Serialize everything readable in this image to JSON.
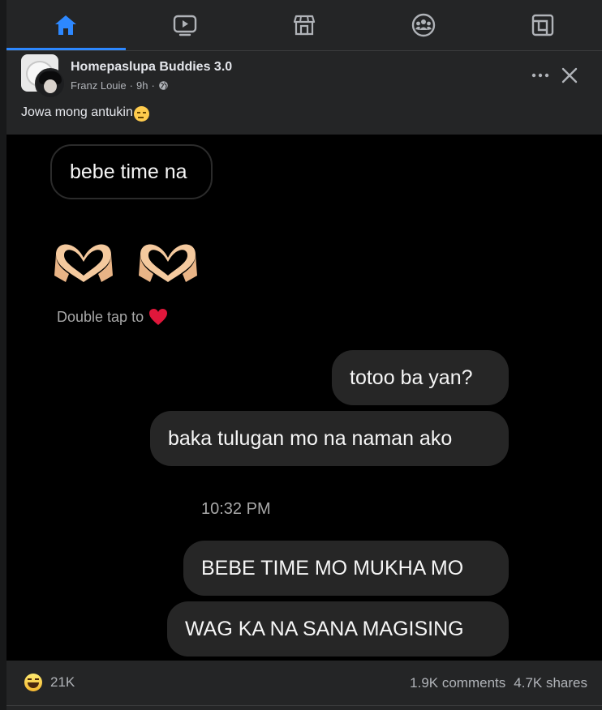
{
  "nav": {
    "tabs": [
      {
        "name": "home",
        "icon": "home-icon",
        "active": true
      },
      {
        "name": "watch",
        "icon": "video-icon",
        "active": false
      },
      {
        "name": "marketplace",
        "icon": "store-icon",
        "active": false
      },
      {
        "name": "groups",
        "icon": "groups-icon",
        "active": false
      },
      {
        "name": "gaming",
        "icon": "gaming-icon",
        "active": false
      }
    ],
    "accent": "#2d88ff"
  },
  "post": {
    "group_name": "Homepaslupa Buddies 3.0",
    "author": "Franz Louie",
    "time": "9h",
    "separator": "·",
    "caption": "Jowa mong antukin",
    "caption_emoji": "expressionless-face-icon"
  },
  "chat": {
    "messages": [
      {
        "text": "bebe time na"
      },
      {
        "text": "totoo ba yan?"
      },
      {
        "text": "baka tulugan mo na naman ako"
      },
      {
        "text": "BEBE TIME MO MUKHA MO"
      },
      {
        "text": "WAG KA NA SANA MAGISING"
      }
    ],
    "double_tap": "Double tap to",
    "timestamp": "10:32 PM"
  },
  "footer": {
    "reactions": "21K",
    "comments": "1.9K comments",
    "shares": "4.7K shares"
  }
}
